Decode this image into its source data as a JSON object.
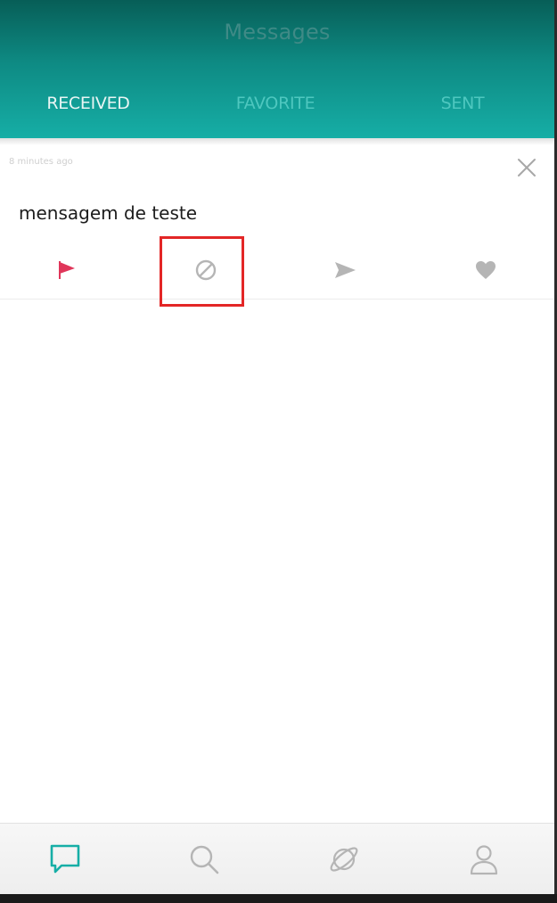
{
  "header": {
    "title": "Messages",
    "tabs": [
      {
        "label": "RECEIVED",
        "active": true
      },
      {
        "label": "FAVORITE",
        "active": false
      },
      {
        "label": "SENT",
        "active": false
      }
    ]
  },
  "message": {
    "timestamp": "8 minutes ago",
    "text": "mensagem de teste",
    "actions": [
      {
        "icon": "flag-icon",
        "color": "#e0365a"
      },
      {
        "icon": "block-icon",
        "color": "#b5b5b5"
      },
      {
        "icon": "send-icon",
        "color": "#b5b5b5"
      },
      {
        "icon": "heart-icon",
        "color": "#b5b5b5"
      }
    ]
  },
  "bottom_nav": {
    "items": [
      {
        "icon": "chat-icon",
        "active": true,
        "color": "#16aea6"
      },
      {
        "icon": "search-icon",
        "active": false,
        "color": "#b5b5b5"
      },
      {
        "icon": "planet-icon",
        "active": false,
        "color": "#b5b5b5"
      },
      {
        "icon": "user-icon",
        "active": false,
        "color": "#b5b5b5"
      }
    ]
  },
  "colors": {
    "accent": "#16aea6",
    "highlight_box": "#e32626"
  }
}
